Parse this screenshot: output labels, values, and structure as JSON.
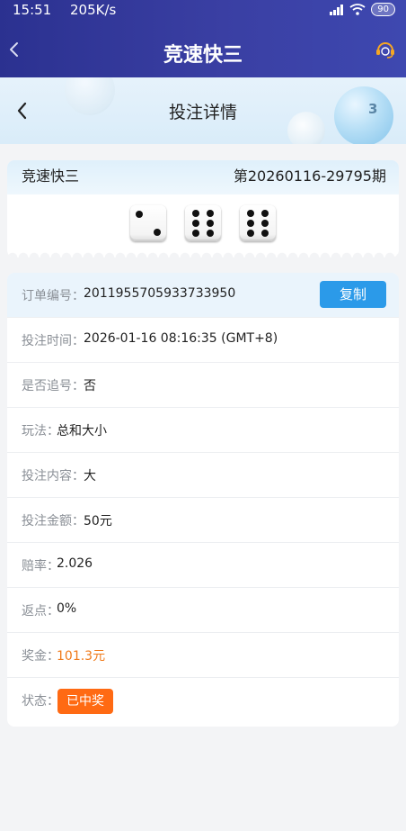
{
  "status_bar": {
    "time": "15:51",
    "net_speed": "205K/s",
    "battery": "90"
  },
  "app_header": {
    "title": "竞速快三"
  },
  "sub_header": {
    "title": "投注详情",
    "ball_number": "3"
  },
  "draw_card": {
    "game_name": "竞速快三",
    "period": "第20260116-29795期",
    "dice": [
      2,
      6,
      6
    ]
  },
  "order": {
    "order_no_label": "订单编号：",
    "order_no": "2011955705933733950",
    "copy_label": "复制",
    "rows": [
      {
        "label": "投注时间：",
        "value": "2026-01-16 08:16:35 (GMT+8)"
      },
      {
        "label": "是否追号：",
        "value": "否"
      },
      {
        "label": "玩法：",
        "value": "总和大小"
      },
      {
        "label": "投注内容：",
        "value": "大"
      },
      {
        "label": "投注金额：",
        "value": "50元"
      },
      {
        "label": "赔率：",
        "value": "2.026"
      },
      {
        "label": "返点：",
        "value": "0%"
      },
      {
        "label": "奖金：",
        "value": "101.3元"
      }
    ],
    "status_label": "状态：",
    "status_value": "已中奖"
  },
  "colors": {
    "header_bg": "#2b3190",
    "copy_button": "#2b9ae9",
    "prize_text": "#f07a1a",
    "status_badge": "#ff6a13"
  }
}
